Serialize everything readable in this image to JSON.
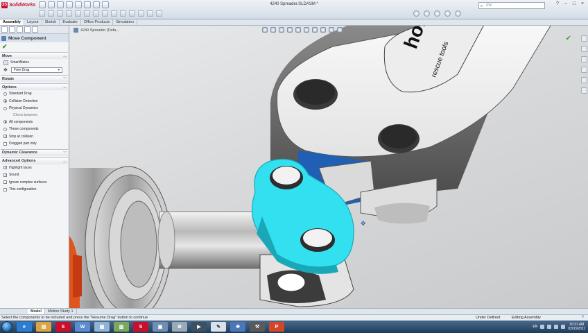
{
  "app": {
    "logo_text": "SolidWorks",
    "document_title": "4240 Spreader.SLDASM *",
    "search_placeholder": "SW"
  },
  "command_tabs": [
    "Assembly",
    "Layout",
    "Sketch",
    "Evaluate",
    "Office Products",
    "Simulation"
  ],
  "property_manager": {
    "title": "Move Component",
    "move_section": "Move",
    "smartmates_label": "SmartMates",
    "move_mode": "Free Drag",
    "rotate_section": "Rotate",
    "options_section": "Options",
    "options": [
      "Standard Drag",
      "Collision Detection",
      "Physical Dynamics"
    ],
    "check_between_label": "Check between:",
    "check_between": [
      "All components",
      "These components"
    ],
    "options_checks": [
      "Stop at collision",
      "Dragged part only"
    ],
    "dynamic_clearance_section": "Dynamic Clearance",
    "advanced_options_section": "Advanced Options",
    "advanced_checks": [
      "Highlight faces",
      "Sound",
      "Ignore complex surfaces",
      "This configuration"
    ]
  },
  "graphics": {
    "tree_label": "4240 Spreader  (Defa...",
    "brand_text": "holmatro",
    "brand_subtext": "rescue tools"
  },
  "bottom_tabs": [
    "Model",
    "Motion Study 1"
  ],
  "status": {
    "message": "Select the components to be included and press the \"Resume Drag\" button to continue",
    "definition": "Under Defined",
    "mode": "Editing Assembly",
    "help": "?"
  },
  "taskbar": {
    "language": "EN",
    "time": "10:31 AM",
    "date": "02/03/2011"
  },
  "colors": {
    "highlight": "#33e0f0",
    "accent": "#1f5fb4",
    "brand_red": "#c8102e"
  }
}
